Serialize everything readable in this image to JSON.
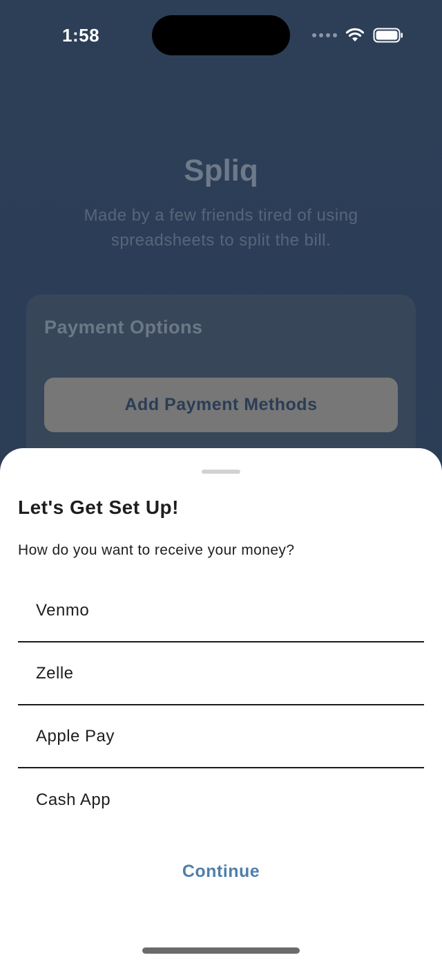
{
  "status_bar": {
    "time": "1:58"
  },
  "background_app": {
    "title": "Spliq",
    "tagline": "Made by a few friends tired of using spreadsheets to split the bill.",
    "payment_card": {
      "title": "Payment Options",
      "button_label": "Add Payment Methods"
    }
  },
  "sheet": {
    "title": "Let's Get Set Up!",
    "question": "How do you want to receive your money?",
    "options": [
      {
        "label": "Venmo"
      },
      {
        "label": "Zelle"
      },
      {
        "label": "Apple Pay"
      },
      {
        "label": "Cash App"
      }
    ],
    "continue_label": "Continue"
  },
  "colors": {
    "background": "#2b3d56",
    "accent": "#4f7faa",
    "sheet": "#ffffff"
  },
  "icons": [
    "signal-icon",
    "wifi-icon",
    "battery-icon"
  ]
}
